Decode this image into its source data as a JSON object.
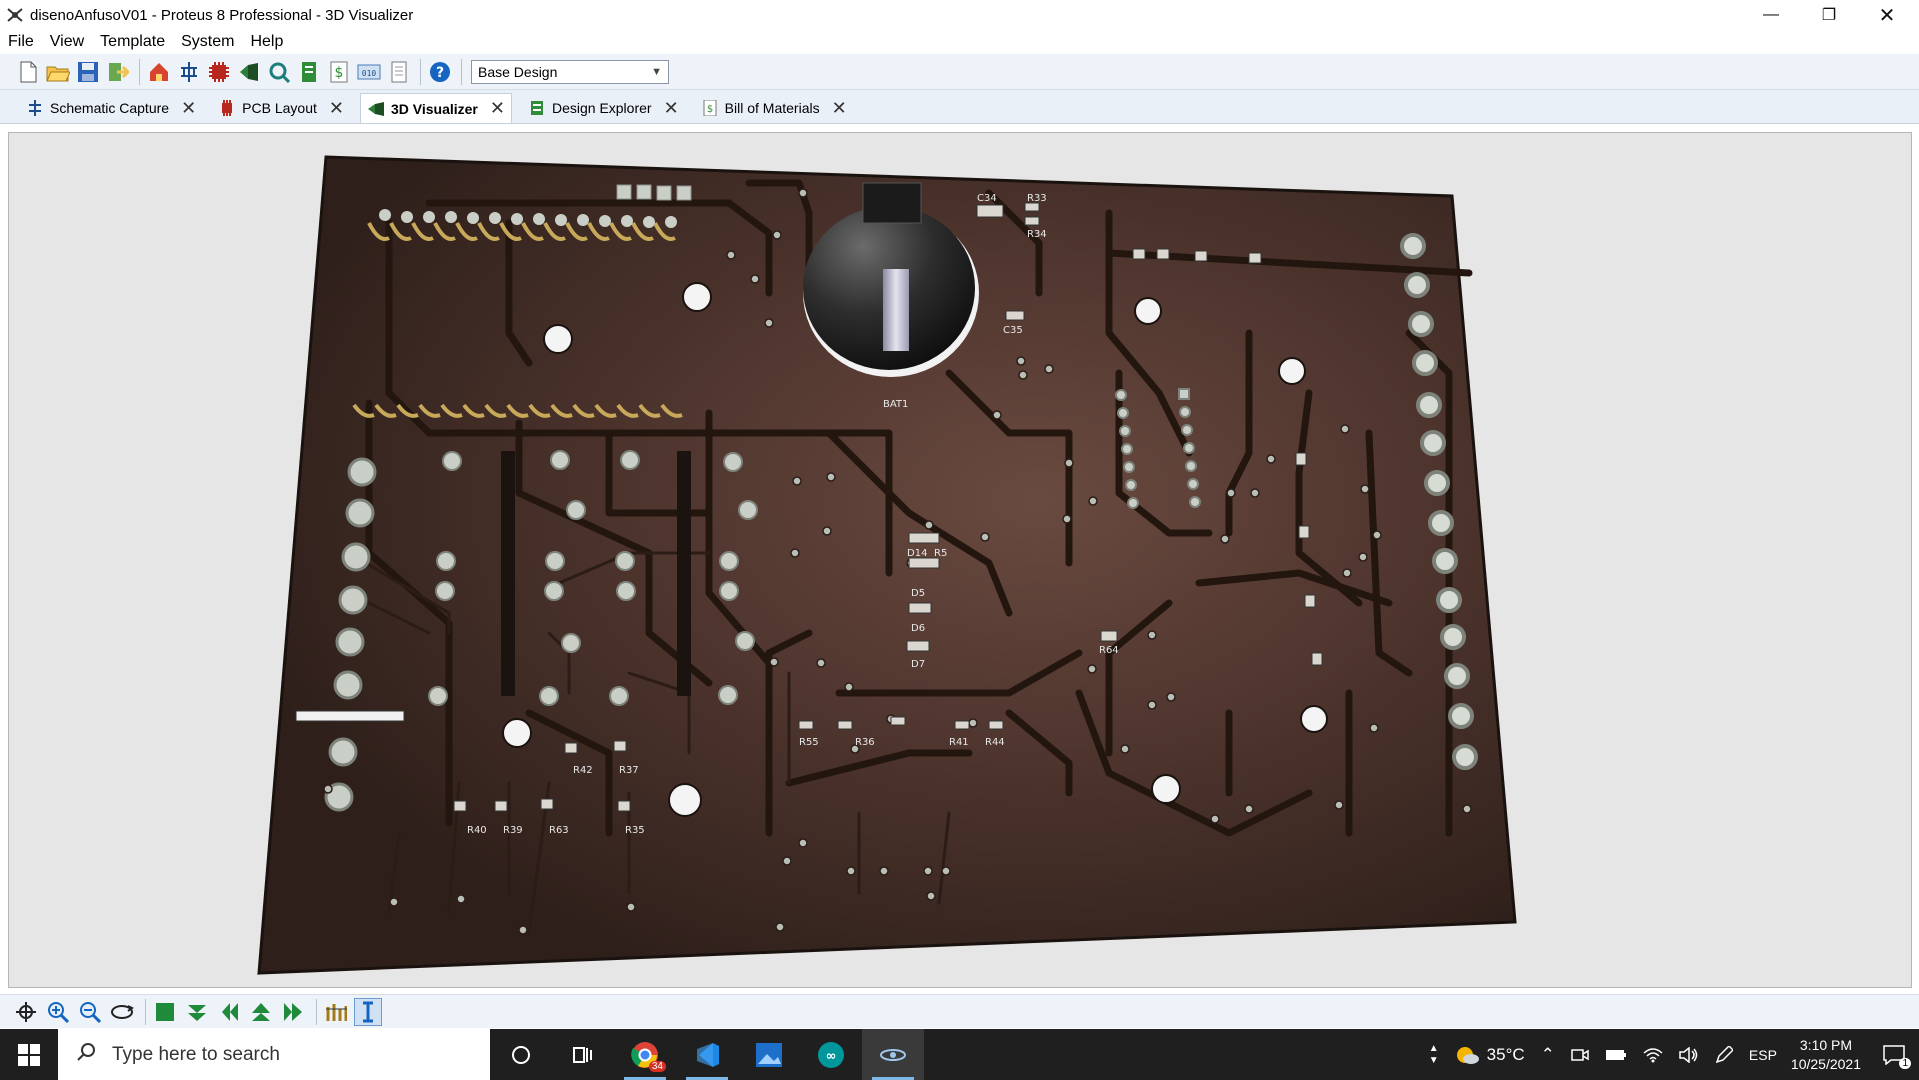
{
  "window": {
    "title": "disenoAnfusoV01 - Proteus 8 Professional - 3D Visualizer",
    "controls": [
      "minimize",
      "restore",
      "close"
    ]
  },
  "menu": [
    "File",
    "View",
    "Template",
    "System",
    "Help"
  ],
  "toolbar": {
    "icons": [
      "new-file-icon",
      "open-folder-icon",
      "save-icon",
      "import-icon",
      "home-icon",
      "schematic-icon",
      "pcb-icon",
      "3d-icon",
      "gerber-icon",
      "bom-icon",
      "dollar-icon",
      "binary-icon",
      "notes-icon",
      "help-icon"
    ],
    "variant_value": "Base Design"
  },
  "tabs": [
    {
      "label": "Schematic Capture",
      "icon": "schematic-icon",
      "active": false
    },
    {
      "label": "PCB Layout",
      "icon": "pcb-icon",
      "active": false
    },
    {
      "label": "3D Visualizer",
      "icon": "3d-icon",
      "active": true
    },
    {
      "label": "Design Explorer",
      "icon": "explorer-icon",
      "active": false
    },
    {
      "label": "Bill of Materials",
      "icon": "bom-icon",
      "active": false
    }
  ],
  "board": {
    "labels": {
      "bat": "BAT1",
      "c34": "C34",
      "r33": "R33",
      "r34": "R34",
      "c35": "C35",
      "d14": "D14",
      "r5": "R5",
      "d5": "D5",
      "d6": "D6",
      "d7": "D7",
      "r40": "R40",
      "r39": "R39",
      "r63": "R63",
      "r35": "R35",
      "r42": "R42",
      "r37": "R37",
      "r55": "R55",
      "r36": "R36",
      "r44": "R44",
      "r41": "R41",
      "r64": "R64"
    },
    "colors": {
      "substrate": "#46302a",
      "trace": "#2a1c17",
      "pad": "#c9cfc6",
      "hole": "#f2f2f2",
      "gold": "#c8a95a"
    }
  },
  "bottom_tools": [
    "move-icon",
    "zoom-in-icon",
    "zoom-out-icon",
    "orbit-icon",
    "top-view-icon",
    "bottom-view-icon",
    "left-view-icon",
    "front-view-icon",
    "right-view-icon",
    "height-icon",
    "measure-icon"
  ],
  "taskbar": {
    "search_placeholder": "Type here to search",
    "badge": "34",
    "temperature": "35°C",
    "language": "ESP",
    "time": "3:10 PM",
    "date": "10/25/2021",
    "notifications": "1"
  }
}
